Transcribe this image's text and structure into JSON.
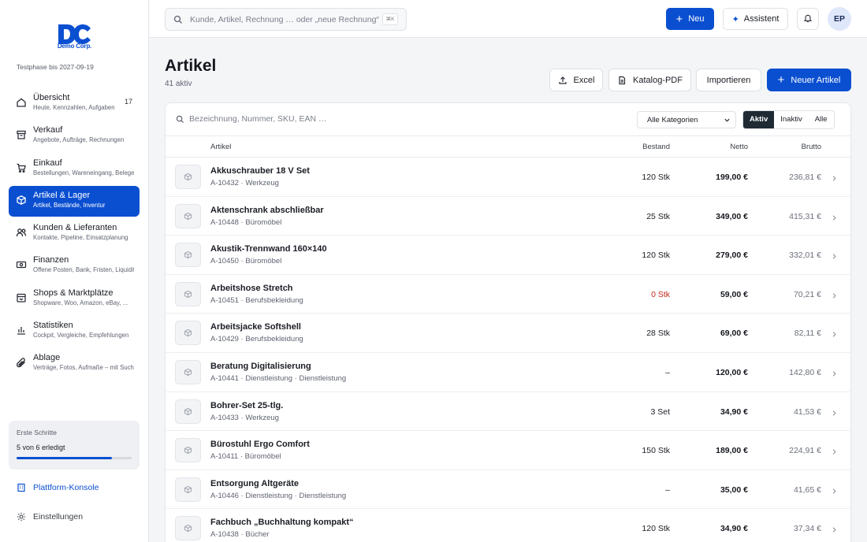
{
  "brand": {
    "logo_text": "DC",
    "name": "Demo Corp.",
    "trial": "Testphase bis 2027-09-19",
    "accent": "#0b4fd1"
  },
  "sidebar": {
    "items": [
      {
        "title": "Übersicht",
        "sub": "Heute, Kennzahlen, Aufgaben",
        "badge": "17",
        "icon": "home-icon"
      },
      {
        "title": "Verkauf",
        "sub": "Angebote, Aufträge, Rechnungen",
        "icon": "archive-icon"
      },
      {
        "title": "Einkauf",
        "sub": "Bestellungen, Wareneingang, Belege",
        "icon": "cart-icon"
      },
      {
        "title": "Artikel & Lager",
        "sub": "Artikel, Bestände, Inventur",
        "icon": "box-icon",
        "active": true
      },
      {
        "title": "Kunden & Lieferanten",
        "sub": "Kontakte, Pipeline, Einsatzplanung",
        "icon": "users-icon"
      },
      {
        "title": "Finanzen",
        "sub": "Offene Posten, Bank, Fristen, Liquidität",
        "icon": "money-icon"
      },
      {
        "title": "Shops & Marktplätze",
        "sub": "Shopware, Woo, Amazon, eBay, ...",
        "icon": "shop-icon"
      },
      {
        "title": "Statistiken",
        "sub": "Cockpit, Vergleiche, Empfehlungen",
        "icon": "chart-icon"
      },
      {
        "title": "Ablage",
        "sub": "Verträge, Fotos, Aufmaße – mit Suche",
        "icon": "paperclip-icon"
      }
    ],
    "steps": {
      "label": "Erste Schritte",
      "count": "5 von 6 erledigt",
      "progress": 0.83
    },
    "platform": "Plattform-Konsole",
    "settings": "Einstellungen"
  },
  "topbar": {
    "search_placeholder": "Kunde, Artikel, Rechnung … oder „neue Rechnung“",
    "shortcut": "⌘K",
    "new_label": "Neu",
    "assistant_label": "Assistent",
    "avatar": "EP"
  },
  "page": {
    "title": "Artikel",
    "subtitle": "41 aktiv",
    "buttons": {
      "excel": "Excel",
      "catalog": "Katalog-PDF",
      "import": "Importieren",
      "new_article": "Neuer Artikel"
    }
  },
  "filters": {
    "search_placeholder": "Bezeichnung, Nummer, SKU, EAN …",
    "category": "Alle Kategorien",
    "segments": [
      "Aktiv",
      "Inaktiv",
      "Alle"
    ],
    "active_segment": "Aktiv"
  },
  "table": {
    "headers": {
      "article": "Artikel",
      "stock": "Bestand",
      "net": "Netto",
      "gross": "Brutto"
    },
    "rows": [
      {
        "name": "Akkuschrauber 18 V Set",
        "meta": "A-10432 · Werkzeug",
        "stock": "120 Stk",
        "net": "199,00 €",
        "gross": "236,81 €"
      },
      {
        "name": "Aktenschrank abschließbar",
        "meta": "A-10448 · Büromöbel",
        "stock": "25 Stk",
        "net": "349,00 €",
        "gross": "415,31 €"
      },
      {
        "name": "Akustik-Trennwand 160×140",
        "meta": "A-10450 · Büromöbel",
        "stock": "120 Stk",
        "net": "279,00 €",
        "gross": "332,01 €"
      },
      {
        "name": "Arbeitshose Stretch",
        "meta": "A-10451 · Berufsbekleidung",
        "stock": "0 Stk",
        "net": "59,00 €",
        "gross": "70,21 €",
        "zero": true
      },
      {
        "name": "Arbeitsjacke Softshell",
        "meta": "A-10429 · Berufsbekleidung",
        "stock": "28 Stk",
        "net": "69,00 €",
        "gross": "82,11 €"
      },
      {
        "name": "Beratung Digitalisierung",
        "meta": "A-10441 · Dienstleistung · Dienstleistung",
        "stock": "–",
        "net": "120,00 €",
        "gross": "142,80 €"
      },
      {
        "name": "Bohrer-Set 25-tlg.",
        "meta": "A-10433 · Werkzeug",
        "stock": "3 Set",
        "net": "34,90 €",
        "gross": "41,53 €"
      },
      {
        "name": "Bürostuhl Ergo Comfort",
        "meta": "A-10411 · Büromöbel",
        "stock": "150 Stk",
        "net": "189,00 €",
        "gross": "224,91 €"
      },
      {
        "name": "Entsorgung Altgeräte",
        "meta": "A-10446 · Dienstleistung · Dienstleistung",
        "stock": "–",
        "net": "35,00 €",
        "gross": "41,65 €"
      },
      {
        "name": "Fachbuch „Buchhaltung kompakt“",
        "meta": "A-10438 · Bücher",
        "stock": "120 Stk",
        "net": "34,90 €",
        "gross": "37,34 €"
      }
    ]
  }
}
